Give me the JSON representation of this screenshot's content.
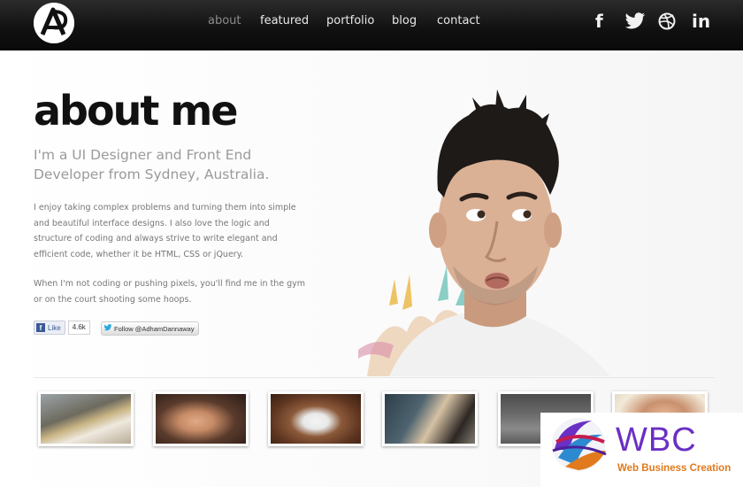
{
  "header": {
    "nav": [
      {
        "label": "about",
        "active": true
      },
      {
        "label": "featured",
        "active": false
      },
      {
        "label": "portfolio",
        "active": false
      },
      {
        "label": "blog",
        "active": false
      },
      {
        "label": "contact",
        "active": false
      }
    ],
    "social": [
      "facebook-icon",
      "twitter-icon",
      "dribbble-icon",
      "linkedin-icon"
    ],
    "social_glyphs": {
      "facebook": "f",
      "twitter": "🐦",
      "dribbble": "⊛",
      "linkedin": "in"
    }
  },
  "main": {
    "title": "about me",
    "subtitle": "I'm a UI Designer and Front End Developer from Sydney, Australia.",
    "paragraph1": "I enjoy taking complex problems and turning them into simple and beautiful interface designs. I also love the logic and structure of coding and always strive to write elegant and efficient code, whether it be HTML, CSS or jQuery.",
    "paragraph2": "When I'm not coding or pushing pixels, you'll find me in the gym or on the court shooting some hoops."
  },
  "social_buttons": {
    "like_label": "Like",
    "like_count": "4.6k",
    "follow_label": "Follow @AdhamDannaway"
  },
  "thumbnails": [
    {
      "name": "desk-setup"
    },
    {
      "name": "sunglasses-selfie"
    },
    {
      "name": "coffee-mug"
    },
    {
      "name": "working-laptop"
    },
    {
      "name": "monitor"
    },
    {
      "name": "portrait-closeup"
    }
  ],
  "watermark": {
    "title": "WBC",
    "subtitle": "Web Business Creation"
  },
  "colors": {
    "header_bg": "#111111",
    "nav_active": "#8c8c8c",
    "wbc_purple": "#6a2fc4",
    "wbc_orange": "#e07a1c"
  }
}
